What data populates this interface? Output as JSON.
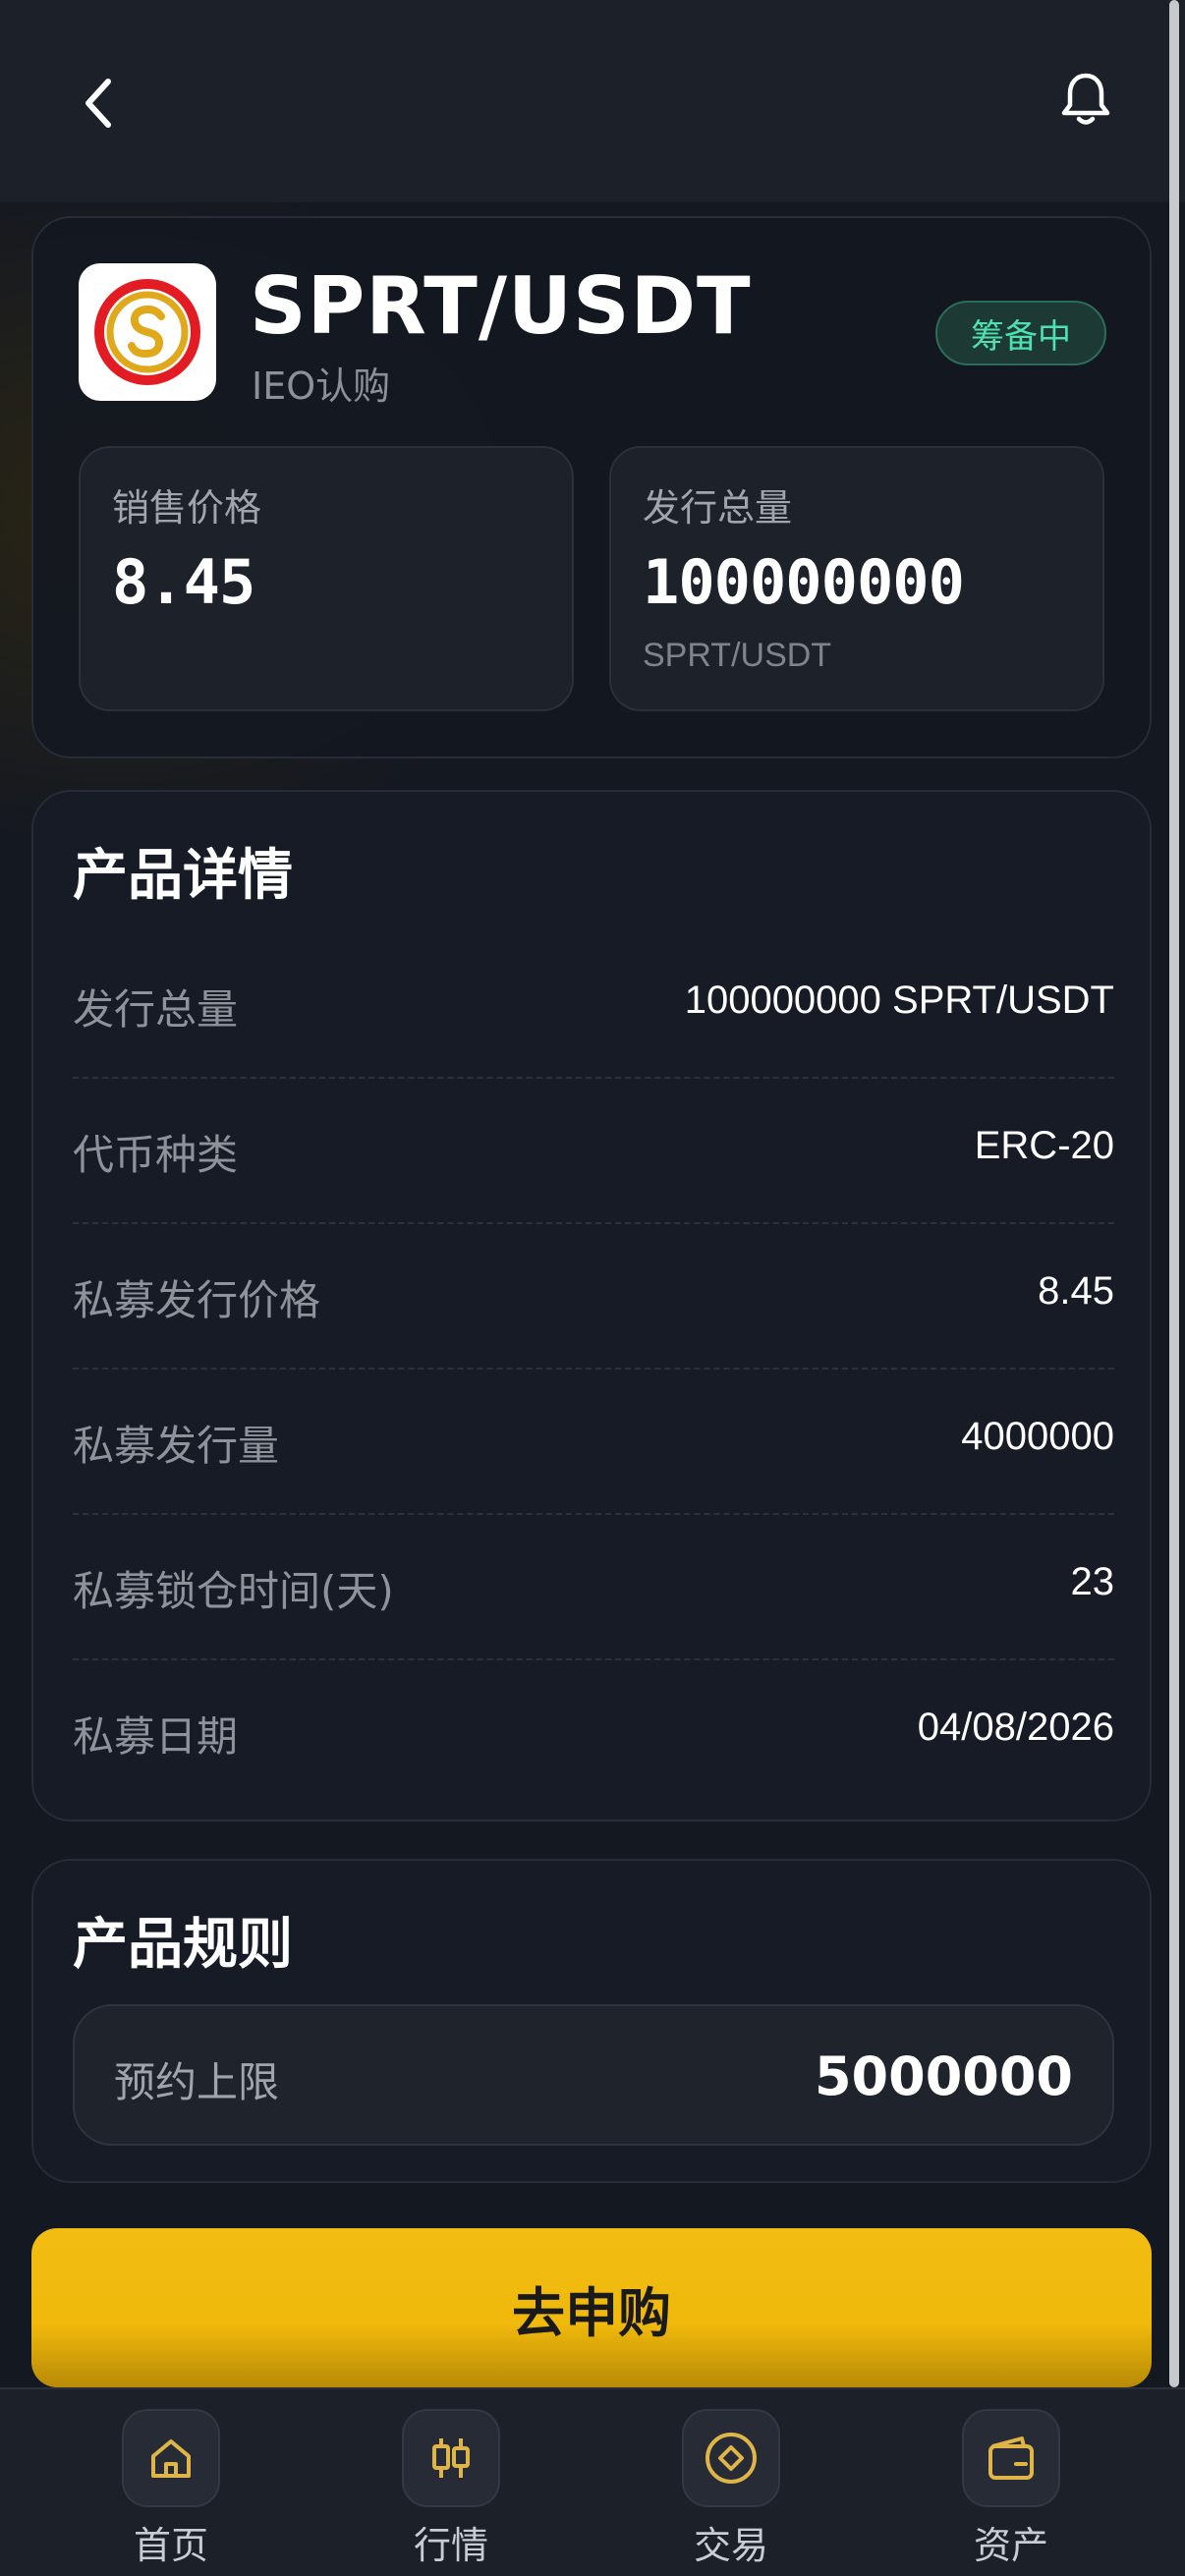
{
  "header": {
    "back_icon": "chevron-left-icon",
    "bell_icon": "bell-icon"
  },
  "token": {
    "pair": "SPRT/USDT",
    "subtitle": "IEO认购",
    "status": "筹备中",
    "status_color": "#4fe0b0"
  },
  "stats": {
    "price_label": "销售价格",
    "price_value": "8.45",
    "supply_label": "发行总量",
    "supply_value": "100000000",
    "supply_unit": "SPRT/USDT"
  },
  "details": {
    "title": "产品详情",
    "rows": [
      {
        "label": "发行总量",
        "value": "100000000 SPRT/USDT"
      },
      {
        "label": "代币种类",
        "value": "ERC-20"
      },
      {
        "label": "私募发行价格",
        "value": "8.45"
      },
      {
        "label": "私募发行量",
        "value": "4000000"
      },
      {
        "label": "私募锁仓时间(天)",
        "value": "23"
      },
      {
        "label": "私募日期",
        "value": "04/08/2026"
      }
    ]
  },
  "rules": {
    "title": "产品规则",
    "limit_label": "预约上限",
    "limit_value": "5000000"
  },
  "cta": {
    "label": "去申购",
    "color": "#f0b90b"
  },
  "nav": {
    "items": [
      {
        "label": "首页",
        "icon": "home-icon"
      },
      {
        "label": "行情",
        "icon": "candlestick-icon"
      },
      {
        "label": "交易",
        "icon": "trade-icon"
      },
      {
        "label": "资产",
        "icon": "wallet-icon"
      }
    ]
  }
}
